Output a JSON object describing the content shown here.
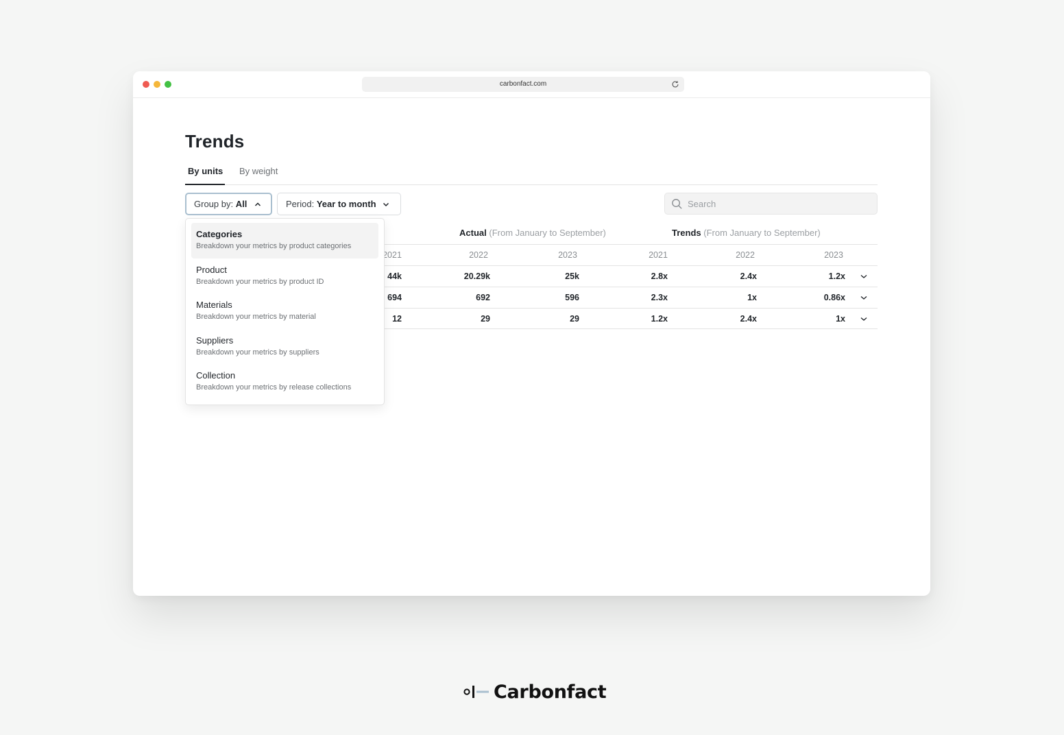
{
  "browser": {
    "url": "carbonfact.com"
  },
  "page": {
    "title": "Trends",
    "tabs": [
      {
        "label": "By units",
        "active": true
      },
      {
        "label": "By weight",
        "active": false
      }
    ],
    "filters": {
      "group_by_label": "Group by:",
      "group_by_value": "All",
      "period_label": "Period:",
      "period_value": "Year to month"
    },
    "search": {
      "placeholder": "Search"
    },
    "table": {
      "actual_title": "Actual",
      "actual_range": "(From January to September)",
      "trends_title": "Trends",
      "trends_range": "(From January to September)",
      "headers": [
        "2021",
        "2022",
        "2023",
        "2021",
        "2022",
        "2023"
      ],
      "rows": [
        [
          "44k",
          "20.29k",
          "25k",
          "2.8x",
          "2.4x",
          "1.2x"
        ],
        [
          "694",
          "692",
          "596",
          "2.3x",
          "1x",
          "0.86x"
        ],
        [
          "12",
          "29",
          "29",
          "1.2x",
          "2.4x",
          "1x"
        ]
      ]
    },
    "dropdown": {
      "items": [
        {
          "title": "Categories",
          "desc": "Breakdown your metrics by product categories",
          "active": true
        },
        {
          "title": "Product",
          "desc": "Breakdown your metrics by product ID",
          "active": false
        },
        {
          "title": "Materials",
          "desc": "Breakdown your metrics by material",
          "active": false
        },
        {
          "title": "Suppliers",
          "desc": "Breakdown your metrics by suppliers",
          "active": false
        },
        {
          "title": "Collection",
          "desc": "Breakdown your metrics by release collections",
          "active": false
        }
      ]
    }
  },
  "brand": {
    "name": "Carbonfact"
  },
  "colors": {
    "background": "#f5f6f5",
    "text": "#1f2328",
    "muted": "#9a9ea2",
    "focus_ring": "#a9bfcf"
  }
}
